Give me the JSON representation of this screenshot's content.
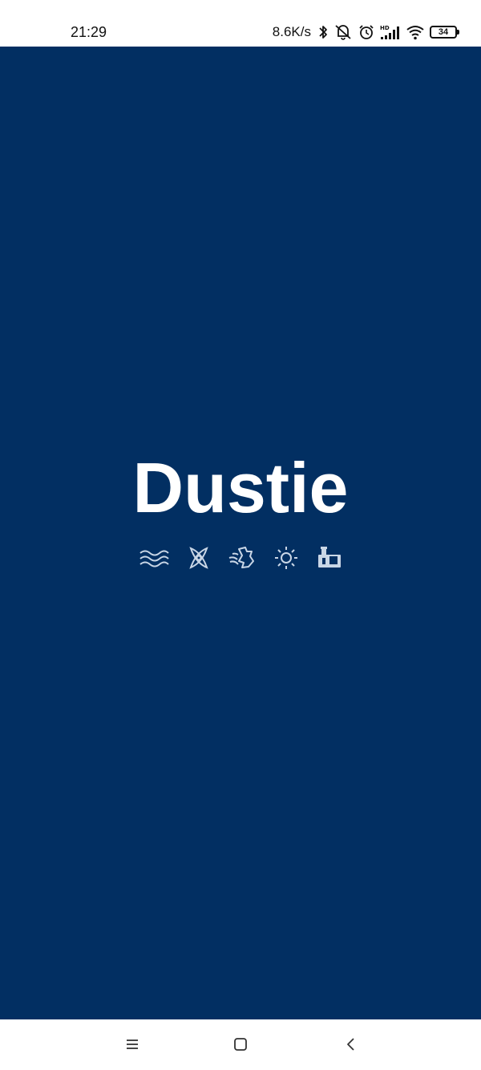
{
  "status_bar": {
    "time": "21:29",
    "net_speed": "8.6K/s",
    "battery_level": "34",
    "icons": [
      "bluetooth-icon",
      "muted-vibrate-icon",
      "alarm-icon",
      "hd-signal-icon",
      "wifi-icon",
      "battery-icon"
    ]
  },
  "splash": {
    "brand_name": "Dustie",
    "background_color": "#022f62",
    "logo_icons": [
      "waves-icon",
      "spinning-blades-icon",
      "wind-cloth-icon",
      "sun-icon",
      "appliance-icon"
    ]
  },
  "nav_bar": {
    "buttons": [
      "menu-icon",
      "home-icon",
      "back-icon"
    ]
  }
}
